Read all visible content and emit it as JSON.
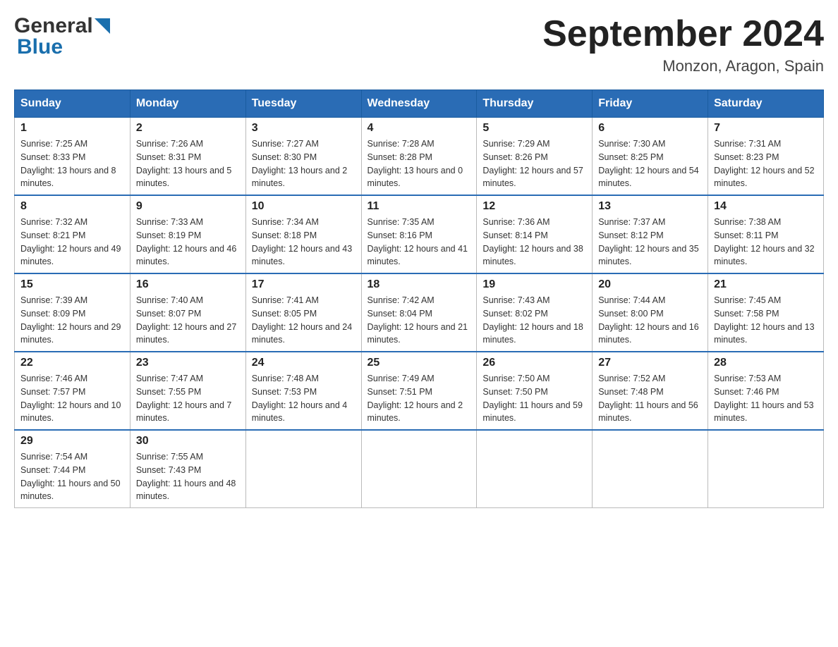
{
  "header": {
    "logo_general": "General",
    "logo_blue": "Blue",
    "title": "September 2024",
    "location": "Monzon, Aragon, Spain"
  },
  "weekdays": [
    "Sunday",
    "Monday",
    "Tuesday",
    "Wednesday",
    "Thursday",
    "Friday",
    "Saturday"
  ],
  "weeks": [
    [
      {
        "day": "1",
        "sunrise": "7:25 AM",
        "sunset": "8:33 PM",
        "daylight": "13 hours and 8 minutes."
      },
      {
        "day": "2",
        "sunrise": "7:26 AM",
        "sunset": "8:31 PM",
        "daylight": "13 hours and 5 minutes."
      },
      {
        "day": "3",
        "sunrise": "7:27 AM",
        "sunset": "8:30 PM",
        "daylight": "13 hours and 2 minutes."
      },
      {
        "day": "4",
        "sunrise": "7:28 AM",
        "sunset": "8:28 PM",
        "daylight": "13 hours and 0 minutes."
      },
      {
        "day": "5",
        "sunrise": "7:29 AM",
        "sunset": "8:26 PM",
        "daylight": "12 hours and 57 minutes."
      },
      {
        "day": "6",
        "sunrise": "7:30 AM",
        "sunset": "8:25 PM",
        "daylight": "12 hours and 54 minutes."
      },
      {
        "day": "7",
        "sunrise": "7:31 AM",
        "sunset": "8:23 PM",
        "daylight": "12 hours and 52 minutes."
      }
    ],
    [
      {
        "day": "8",
        "sunrise": "7:32 AM",
        "sunset": "8:21 PM",
        "daylight": "12 hours and 49 minutes."
      },
      {
        "day": "9",
        "sunrise": "7:33 AM",
        "sunset": "8:19 PM",
        "daylight": "12 hours and 46 minutes."
      },
      {
        "day": "10",
        "sunrise": "7:34 AM",
        "sunset": "8:18 PM",
        "daylight": "12 hours and 43 minutes."
      },
      {
        "day": "11",
        "sunrise": "7:35 AM",
        "sunset": "8:16 PM",
        "daylight": "12 hours and 41 minutes."
      },
      {
        "day": "12",
        "sunrise": "7:36 AM",
        "sunset": "8:14 PM",
        "daylight": "12 hours and 38 minutes."
      },
      {
        "day": "13",
        "sunrise": "7:37 AM",
        "sunset": "8:12 PM",
        "daylight": "12 hours and 35 minutes."
      },
      {
        "day": "14",
        "sunrise": "7:38 AM",
        "sunset": "8:11 PM",
        "daylight": "12 hours and 32 minutes."
      }
    ],
    [
      {
        "day": "15",
        "sunrise": "7:39 AM",
        "sunset": "8:09 PM",
        "daylight": "12 hours and 29 minutes."
      },
      {
        "day": "16",
        "sunrise": "7:40 AM",
        "sunset": "8:07 PM",
        "daylight": "12 hours and 27 minutes."
      },
      {
        "day": "17",
        "sunrise": "7:41 AM",
        "sunset": "8:05 PM",
        "daylight": "12 hours and 24 minutes."
      },
      {
        "day": "18",
        "sunrise": "7:42 AM",
        "sunset": "8:04 PM",
        "daylight": "12 hours and 21 minutes."
      },
      {
        "day": "19",
        "sunrise": "7:43 AM",
        "sunset": "8:02 PM",
        "daylight": "12 hours and 18 minutes."
      },
      {
        "day": "20",
        "sunrise": "7:44 AM",
        "sunset": "8:00 PM",
        "daylight": "12 hours and 16 minutes."
      },
      {
        "day": "21",
        "sunrise": "7:45 AM",
        "sunset": "7:58 PM",
        "daylight": "12 hours and 13 minutes."
      }
    ],
    [
      {
        "day": "22",
        "sunrise": "7:46 AM",
        "sunset": "7:57 PM",
        "daylight": "12 hours and 10 minutes."
      },
      {
        "day": "23",
        "sunrise": "7:47 AM",
        "sunset": "7:55 PM",
        "daylight": "12 hours and 7 minutes."
      },
      {
        "day": "24",
        "sunrise": "7:48 AM",
        "sunset": "7:53 PM",
        "daylight": "12 hours and 4 minutes."
      },
      {
        "day": "25",
        "sunrise": "7:49 AM",
        "sunset": "7:51 PM",
        "daylight": "12 hours and 2 minutes."
      },
      {
        "day": "26",
        "sunrise": "7:50 AM",
        "sunset": "7:50 PM",
        "daylight": "11 hours and 59 minutes."
      },
      {
        "day": "27",
        "sunrise": "7:52 AM",
        "sunset": "7:48 PM",
        "daylight": "11 hours and 56 minutes."
      },
      {
        "day": "28",
        "sunrise": "7:53 AM",
        "sunset": "7:46 PM",
        "daylight": "11 hours and 53 minutes."
      }
    ],
    [
      {
        "day": "29",
        "sunrise": "7:54 AM",
        "sunset": "7:44 PM",
        "daylight": "11 hours and 50 minutes."
      },
      {
        "day": "30",
        "sunrise": "7:55 AM",
        "sunset": "7:43 PM",
        "daylight": "11 hours and 48 minutes."
      },
      null,
      null,
      null,
      null,
      null
    ]
  ]
}
